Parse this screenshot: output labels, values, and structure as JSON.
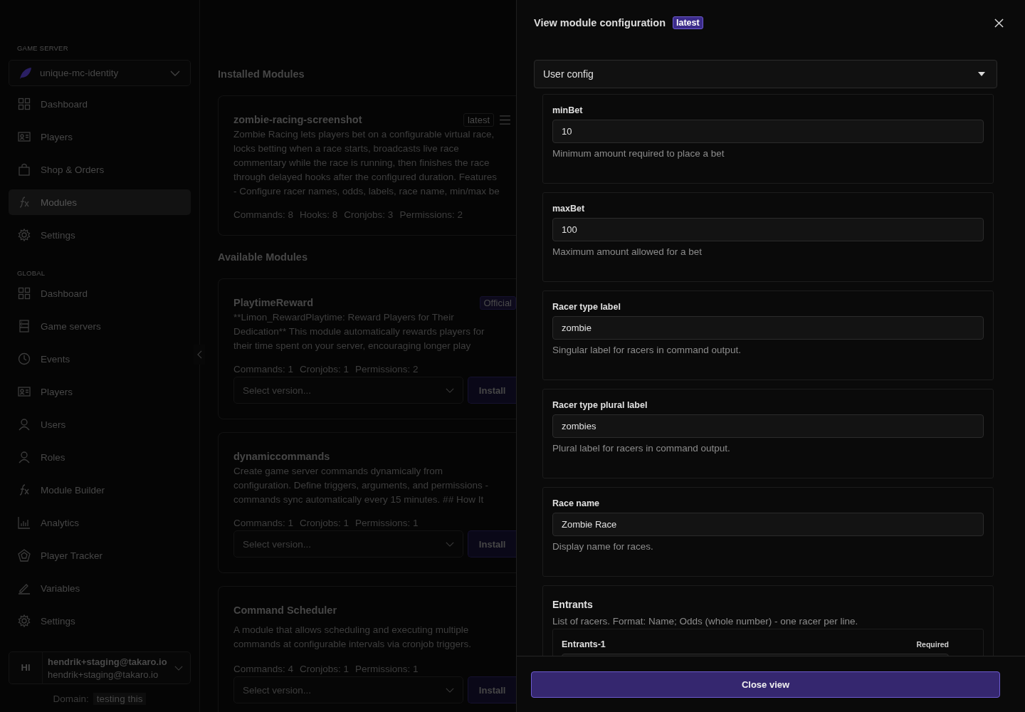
{
  "sidebar": {
    "sections": [
      {
        "heading": "GAME SERVER",
        "items": [
          {
            "label": "Dashboard",
            "kind": "grid",
            "selected": false
          },
          {
            "label": "Players",
            "kind": "card",
            "selected": false
          },
          {
            "label": "Shop & Orders",
            "kind": "bag",
            "selected": false
          },
          {
            "label": "Modules",
            "kind": "fx",
            "selected": true
          },
          {
            "label": "Settings",
            "kind": "gear",
            "selected": false
          }
        ]
      },
      {
        "heading": "GLOBAL",
        "items": [
          {
            "label": "Dashboard",
            "kind": "grid",
            "selected": false
          },
          {
            "label": "Game servers",
            "kind": "server",
            "selected": false
          },
          {
            "label": "Events",
            "kind": "clock",
            "selected": false
          },
          {
            "label": "Players",
            "kind": "card",
            "selected": false
          },
          {
            "label": "Users",
            "kind": "person",
            "selected": false
          },
          {
            "label": "Roles",
            "kind": "person",
            "selected": false
          },
          {
            "label": "Module Builder",
            "kind": "fx",
            "selected": false
          },
          {
            "label": "Analytics",
            "kind": "chart",
            "selected": false
          },
          {
            "label": "Player Tracker",
            "kind": "radar",
            "selected": false
          },
          {
            "label": "Variables",
            "kind": "pen",
            "selected": false
          },
          {
            "label": "Settings",
            "kind": "gear",
            "selected": false
          }
        ]
      }
    ],
    "server_select": {
      "value": "unique-mc-identity"
    },
    "user": {
      "initials": "HI",
      "name": "hendrik+staging@takaro.io",
      "email": "hendrik+staging@takaro.io"
    },
    "domain": {
      "label": "Domain:",
      "value": "testing this"
    }
  },
  "main": {
    "installed_heading": "Installed Modules",
    "installed": [
      {
        "title": "zombie-racing-screenshot",
        "badge": "latest",
        "description_lines": [
          "Zombie Racing lets players bet on a configurable virtual race,",
          "locks betting when a race starts, broadcasts live race",
          "commentary while the race is running, then finishes the race",
          "through delayed hooks after the configured duration. Features",
          "- Configure racer names, odds, labels, race name, min/max be"
        ],
        "stats": [
          "Commands: 8",
          "Hooks: 8",
          "Cronjobs: 3",
          "Permissions: 2"
        ]
      }
    ],
    "available_heading": "Available Modules",
    "available": [
      {
        "title": "PlaytimeReward",
        "badge": "Official",
        "description_lines": [
          "**Limon_RewardPlaytime: Reward Players for Their",
          "Dedication** This module automatically rewards players for",
          "their time spent on your server, encouraging longer play"
        ],
        "stats": [
          "Commands: 1",
          "Cronjobs: 1",
          "Permissions: 2"
        ],
        "version_placeholder": "Select version...",
        "install": "Install"
      },
      {
        "title": "dynamiccommands",
        "description_lines": [
          "Create game server commands dynamically from",
          "configuration. Define triggers, arguments, and permissions -",
          "commands sync automatically every 15 minutes. ## How It"
        ],
        "stats": [
          "Commands: 1",
          "Cronjobs: 1",
          "Permissions: 1"
        ],
        "version_placeholder": "Select version...",
        "install": "Install"
      },
      {
        "title": "Command Scheduler",
        "description_lines": [
          "A module that allows scheduling and executing multiple",
          "commands at configurable intervals via cronjob triggers."
        ],
        "stats": [
          "Commands: 4",
          "Cronjobs: 1",
          "Permissions: 1"
        ],
        "version_placeholder": "Select version...",
        "install": "Install"
      }
    ]
  },
  "drawer": {
    "title": "View module configuration",
    "badge": "latest",
    "config_select": "User config",
    "fields": [
      {
        "label": "minBet",
        "value": "10",
        "help": "Minimum amount required to place a bet"
      },
      {
        "label": "maxBet",
        "value": "100",
        "help": "Maximum amount allowed for a bet"
      },
      {
        "label": "Racer type label",
        "value": "zombie",
        "help": "Singular label for racers in command output."
      },
      {
        "label": "Racer type plural label",
        "value": "zombies",
        "help": "Plural label for racers in command output."
      },
      {
        "label": "Race name",
        "value": "Zombie Race",
        "help": "Display name for races."
      }
    ],
    "entrants": {
      "label": "Entrants",
      "help": "List of racers. Format: Name; Odds (whole number) - one racer per line.",
      "item_label": "Entrants-1",
      "required": "Required"
    },
    "close_button": "Close view"
  }
}
